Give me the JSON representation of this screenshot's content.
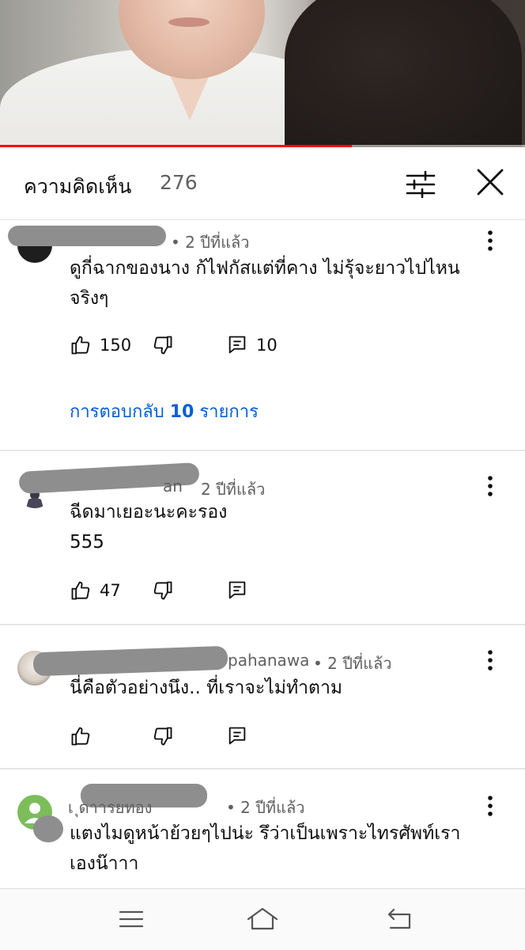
{
  "video": {
    "progress_percent": 67
  },
  "header": {
    "title": "ความคิดเห็น",
    "count": "276"
  },
  "comments": [
    {
      "author_suffix": "",
      "time": "• 2 ปีที่แล้ว",
      "text_lines": [
        "ดูกี่ฉากของนาง ก้ไฟกัสแต่ที่คาง ไม่รุ้จะยาวไปไหน",
        "จริงๆ"
      ],
      "likes": "150",
      "reply_count": "10",
      "replies_prefix": "การตอบกลับ",
      "replies_number": "10",
      "replies_suffix": "รายการ"
    },
    {
      "author_suffix": "an",
      "time": "2 ปีที่แล้ว",
      "text_lines": [
        "ฉีดมาเยอะนะคะรอง",
        "555"
      ],
      "likes": "47"
    },
    {
      "author_suffix": "pahanawa",
      "time": "• 2 ปีที่แล้ว",
      "text_lines": [
        "นี่คือตัวอย่างนึง.. ที่เราจะไม่ทำตาม"
      ]
    },
    {
      "author_suffix": "เ      ุดาารยทอง",
      "time": "• 2 ปีที่แล้ว",
      "text_lines": [
        "แตงไมดูหน้าย้วยๆไปน่ะ รึว่าเป็นเพราะไทรศัพท์เรา",
        "เองน๊าาา"
      ]
    }
  ],
  "icons": {
    "like": "thumb-up-icon",
    "dislike": "thumb-down-icon",
    "reply": "comment-reply-icon",
    "menu": "more-vertical-icon",
    "filter": "sliders-icon",
    "close": "close-icon",
    "nav_menu": "hamburger-icon",
    "nav_home": "home-icon",
    "nav_back": "back-icon"
  },
  "colors": {
    "accent_link": "#065fd4",
    "progress": "#ff0000",
    "meta_text": "#606060"
  }
}
